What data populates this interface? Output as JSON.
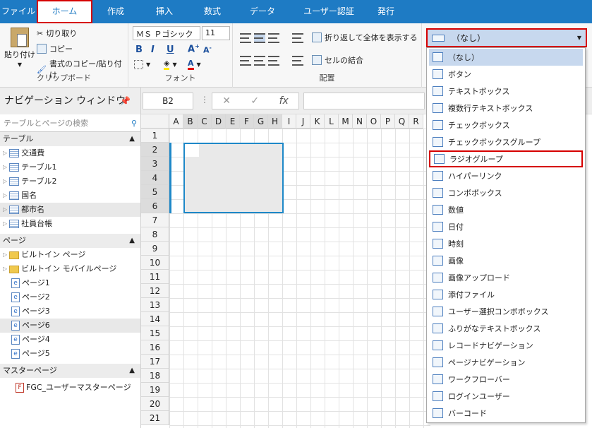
{
  "tabs": [
    "ファイル",
    "ホーム",
    "作成",
    "挿入",
    "数式",
    "データ",
    "ユーザー認証",
    "発行"
  ],
  "ribbon": {
    "paste": "貼り付け",
    "cut": "切り取り",
    "copy": "コピー",
    "copy_format": "書式のコピー/貼り付け",
    "clipboard": "クリップボード",
    "font_name": "ＭＳ Ｐゴシック",
    "font_size": "11",
    "font": "フォント",
    "wrap": "折り返して全体を表示する",
    "merge": "セルの結合",
    "placement": "配置",
    "dropdown_value": "（なし）"
  },
  "nav": {
    "title": "ナビゲーション ウィンドウ",
    "search_placeholder": "テーブルとページの検索",
    "tables_header": "テーブル",
    "tables": [
      "交通費",
      "テーブル1",
      "テーブル2",
      "国名",
      "都市名",
      "社員台帳"
    ],
    "pages_header": "ページ",
    "folders": [
      "ビルトイン ページ",
      "ビルトイン モバイルページ"
    ],
    "pages": [
      "ページ1",
      "ページ2",
      "ページ3",
      "ページ6",
      "ページ4",
      "ページ5"
    ],
    "master_header": "マスターページ",
    "masters": [
      "FGC_ユーザーマスターページ"
    ]
  },
  "formula": {
    "cell_ref": "B2",
    "fx": "fx"
  },
  "columns": [
    "A",
    "B",
    "C",
    "D",
    "E",
    "F",
    "G",
    "H",
    "I",
    "J",
    "K",
    "L",
    "M",
    "N",
    "O",
    "P",
    "Q",
    "R"
  ],
  "rows": [
    "1",
    "2",
    "3",
    "4",
    "5",
    "6",
    "7",
    "8",
    "9",
    "10",
    "11",
    "12",
    "13",
    "14",
    "15",
    "16",
    "17",
    "18",
    "19",
    "20",
    "21"
  ],
  "menu": {
    "items": [
      {
        "label": "（なし）",
        "icon": "blank-box-icon"
      },
      {
        "label": "ボタン",
        "icon": "button-icon"
      },
      {
        "label": "テキストボックス",
        "icon": "textbox-icon"
      },
      {
        "label": "複数行テキストボックス",
        "icon": "multiline-icon"
      },
      {
        "label": "チェックボックス",
        "icon": "checkbox-icon"
      },
      {
        "label": "チェックボックスグループ",
        "icon": "checkbox-group-icon"
      },
      {
        "label": "ラジオグループ",
        "icon": "radio-icon"
      },
      {
        "label": "ハイパーリンク",
        "icon": "link-icon"
      },
      {
        "label": "コンボボックス",
        "icon": "combobox-icon"
      },
      {
        "label": "数値",
        "icon": "number-icon"
      },
      {
        "label": "日付",
        "icon": "calendar-icon"
      },
      {
        "label": "時刻",
        "icon": "clock-icon"
      },
      {
        "label": "画像",
        "icon": "image-icon"
      },
      {
        "label": "画像アップロード",
        "icon": "image-upload-icon"
      },
      {
        "label": "添付ファイル",
        "icon": "paperclip-icon"
      },
      {
        "label": "ユーザー選択コンボボックス",
        "icon": "users-icon"
      },
      {
        "label": "ふりがなテキストボックス",
        "icon": "furigana-icon"
      },
      {
        "label": "レコードナビゲーション",
        "icon": "record-nav-icon"
      },
      {
        "label": "ページナビゲーション",
        "icon": "page-nav-icon"
      },
      {
        "label": "ワークフローバー",
        "icon": "workflow-icon"
      },
      {
        "label": "ログインユーザー",
        "icon": "login-user-icon"
      },
      {
        "label": "バーコード",
        "icon": "barcode-icon"
      }
    ]
  }
}
